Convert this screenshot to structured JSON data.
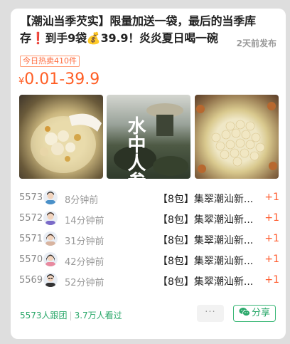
{
  "post": {
    "title_line1": "【潮汕当季芡实】限量加送一袋，最后的当季库",
    "title_line2": "存❗到手9袋💰39.9！炎炎夏日喝一碗",
    "posted_time": "2天前发布",
    "hot_tag": "今日热卖410件",
    "price_currency": "¥",
    "price_range": "0.01-39.9",
    "image2_overlay_text": "水中人参"
  },
  "orders": [
    {
      "num": "5573",
      "ago": "8分钟前",
      "product": "【8包】集翠潮汕新...",
      "qty": "+1"
    },
    {
      "num": "5572",
      "ago": "14分钟前",
      "product": "【8包】集翠潮汕新...",
      "qty": "+1"
    },
    {
      "num": "5571",
      "ago": "31分钟前",
      "product": "【8包】集翠潮汕新...",
      "qty": "+1"
    },
    {
      "num": "5570",
      "ago": "42分钟前",
      "product": "【8包】集翠潮汕新...",
      "qty": "+1"
    },
    {
      "num": "5569",
      "ago": "52分钟前",
      "product": "【8包】集翠潮汕新...",
      "qty": "+1"
    }
  ],
  "footer": {
    "followers": "5573人跟团",
    "views": "3.7万人看过",
    "more_label": "···",
    "share_label": "分享"
  },
  "colors": {
    "price": "#ff5e25",
    "accent_green": "#2aa86a",
    "plus": "#ff5a2c"
  }
}
